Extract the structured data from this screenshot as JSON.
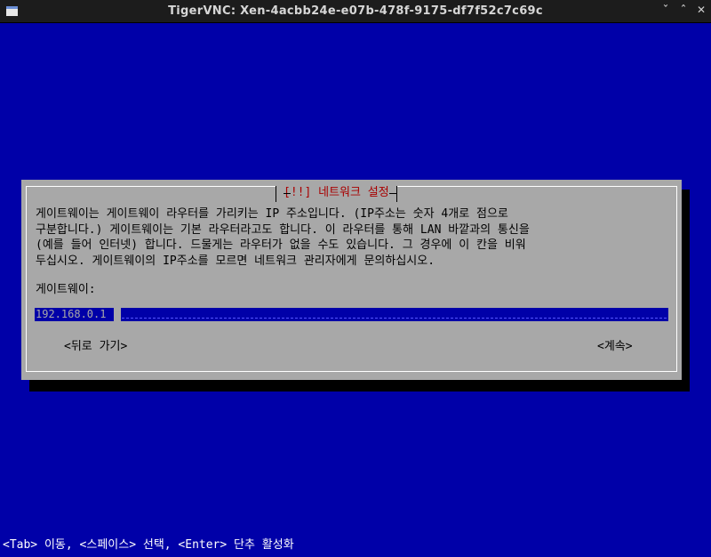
{
  "window": {
    "title": "TigerVNC: Xen-4acbb24e-e07b-478f-9175-df7f52c7c69c",
    "controls": [
      "ˇ",
      "ˆ",
      "✕"
    ]
  },
  "dialog": {
    "title": "[!!] 네트워크 설정",
    "description_lines": [
      "게이트웨이는 게이트웨이 라우터를 가리키는 IP 주소입니다. (IP주소는 숫자 4개로 점으로",
      "구분합니다.) 게이트웨이는 기본 라우터라고도 합니다. 이 라우터를 통해 LAN 바깥과의 통신을",
      "(예를 들어 인터넷) 합니다. 드물게는 라우터가 없을 수도 있습니다. 그 경우에 이 칸을 비워",
      "두십시오. 게이트웨이의 IP주소를 모르면 네트워크 관리자에게 문의하십시오."
    ],
    "field_label": "게이트웨이:",
    "gateway_value": "192.168.0.1",
    "back_button": "<뒤로 가기>",
    "continue_button": "<계속>"
  },
  "footer": {
    "help": "<Tab> 이동, <스페이스> 선택, <Enter> 단추 활성화"
  },
  "colors": {
    "background": "#0000a8",
    "dialog": "#a8a8a8",
    "title_accent": "#a80000",
    "titlebar": "#1c1c1c"
  }
}
